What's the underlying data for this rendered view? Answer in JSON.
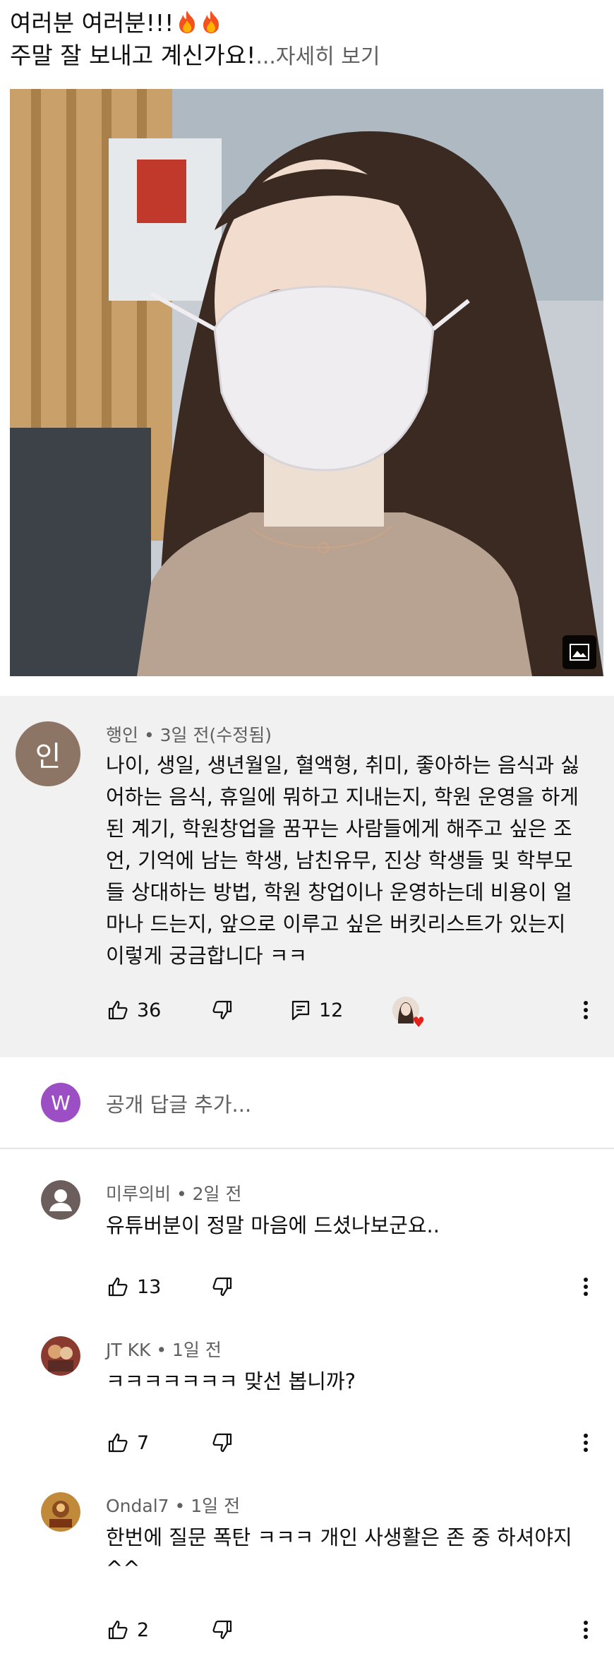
{
  "post": {
    "line1": "여러분 여러분!!!",
    "line2": "주말 잘 보내고 계신가요!",
    "more": "...자세히 보기",
    "emoji": "fire-emoji"
  },
  "main_comment": {
    "avatar_text": "인",
    "author": "행인",
    "time": " • 3일 전(수정됨)",
    "lines": [
      "나이, 생일, 생년월일, 혈액형, 취미, 좋아하는 음식과 싫",
      "어하는 음식, 휴일에 뭐하고 지내는지, 학원 운영을 하게",
      "된 계기, 학원창업을 꿈꾸는 사람들에게 해주고 싶은 조",
      "언, 기억에 남는 학생, 남친유무, 진상 학생들 및 학부모",
      "들 상대하는 방법, 학원 창업이나 운영하는데 비용이 얼",
      "마나 드는지, 앞으로 이루고 싶은 버킷리스트가 있는지",
      "이렇게 궁금합니다 ㅋㅋ"
    ],
    "likes": "36",
    "replies": "12"
  },
  "reply_box": {
    "avatar_text": "W",
    "placeholder": "공개 답글 추가..."
  },
  "replies": [
    {
      "author": "미루의비",
      "time": " • 2일 전",
      "text": "유튜버분이 정말 마음에 드셨나보군요..",
      "likes": "13"
    },
    {
      "author": "JT KK",
      "time": " • 1일 전",
      "text": "ㅋㅋㅋㅋㅋㅋㅋ 맞선 봅니까?",
      "likes": "7"
    },
    {
      "author": "Ondal7",
      "time": " • 1일 전",
      "text": "한번에  질문 폭탄 ㅋㅋㅋ 개인 사생활은 존 중 하셔야지 ^^",
      "likes": "2"
    }
  ],
  "colors": {
    "background": "#ffffff",
    "comment_bg": "#f1f1f1",
    "meta": "#606060",
    "heart": "#e62117",
    "avatar_w": "#9c4fc4"
  }
}
